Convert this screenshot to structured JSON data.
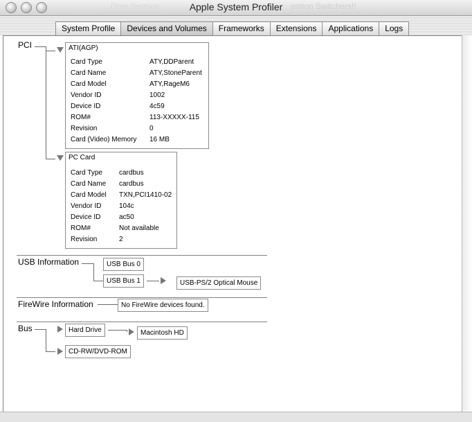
{
  "window": {
    "title": "Apple System Profiler",
    "ghost_left": "Dom Sermon",
    "ghost_right": "ention Switchers!!"
  },
  "tabs": [
    "System Profile",
    "Devices and Volumes",
    "Frameworks",
    "Extensions",
    "Applications",
    "Logs"
  ],
  "active_tab": "Devices and Volumes",
  "pci": {
    "label": "PCI",
    "ati": {
      "title": "ATI(AGP)",
      "rows": [
        {
          "k": "Card Type",
          "v": "ATY,DDParent"
        },
        {
          "k": "Card Name",
          "v": "ATY,StoneParent"
        },
        {
          "k": "Card Model",
          "v": "ATY,RageM6"
        },
        {
          "k": "Vendor ID",
          "v": "1002"
        },
        {
          "k": "Device ID",
          "v": "4c59"
        },
        {
          "k": "ROM#",
          "v": "113-XXXXX-115"
        },
        {
          "k": "Revision",
          "v": "0"
        },
        {
          "k": "Card (Video) Memory",
          "v": "16 MB"
        }
      ]
    },
    "pccard": {
      "title": "PC Card",
      "rows": [
        {
          "k": "Card Type",
          "v": "cardbus"
        },
        {
          "k": "Card Name",
          "v": "cardbus"
        },
        {
          "k": "Card Model",
          "v": "TXN,PCI1410-02"
        },
        {
          "k": "Vendor ID",
          "v": "104c"
        },
        {
          "k": "Device ID",
          "v": "ac50"
        },
        {
          "k": "ROM#",
          "v": "Not available"
        },
        {
          "k": "Revision",
          "v": "2"
        }
      ]
    }
  },
  "usb": {
    "label": "USB Information",
    "bus0": "USB Bus 0",
    "bus1": "USB Bus 1",
    "device": "USB-PS/2 Optical Mouse"
  },
  "firewire": {
    "label": "FireWire Information",
    "value": "No FireWire devices found."
  },
  "bus": {
    "label": "Bus",
    "hard_drive": "Hard Drive",
    "volume": "Macintosh HD",
    "optical": "CD-RW/DVD-ROM"
  }
}
